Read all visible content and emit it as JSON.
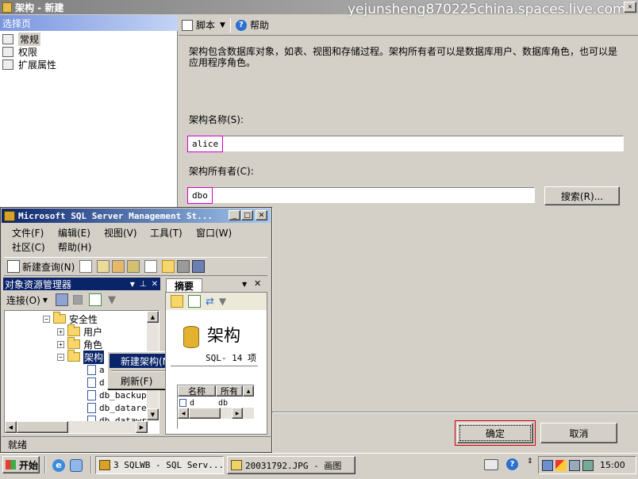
{
  "dialog": {
    "title": "架构 - 新建",
    "watermark": "yejunsheng870225china.spaces.live.com",
    "select_page_label": "选择页",
    "pages": [
      {
        "label": "常规"
      },
      {
        "label": "权限"
      },
      {
        "label": "扩展属性"
      }
    ],
    "toolbar": {
      "script_label": "脚本",
      "help_label": "帮助"
    },
    "description": "架构包含数据库对象，如表、视图和存储过程。架构所有者可以是数据库用户、数据库角色，也可以是应用程序角色。",
    "schema_name_label": "架构名称(S):",
    "schema_name_value": "alice",
    "schema_owner_label": "架构所有者(C):",
    "schema_owner_value": "dbo",
    "search_button": "搜索(R)...",
    "ok_button": "确定",
    "cancel_button": "取消"
  },
  "ssms": {
    "title": "Microsoft SQL Server Management St...",
    "menu": [
      "文件(F)",
      "编辑(E)",
      "视图(V)",
      "工具(T)",
      "窗口(W)",
      "社区(C)",
      "帮助(H)"
    ],
    "new_query": "新建查询(N)",
    "object_explorer_title": "对象资源管理器",
    "connect_label": "连接(O)",
    "tree": [
      {
        "label": "安全性"
      },
      {
        "label": "用户"
      },
      {
        "label": "角色"
      },
      {
        "label": "架构"
      },
      {
        "label": "a"
      },
      {
        "label": "d"
      },
      {
        "label": "db_backup"
      },
      {
        "label": "db_datare"
      },
      {
        "label": "db_datawr"
      }
    ],
    "context_menu": [
      "新建架构(N)...",
      "刷新(F)"
    ],
    "summary_tab": "摘要",
    "summary_title": "架构",
    "summary_subtitle": "SQL- 14 项",
    "list_headers": [
      "名称",
      "所有"
    ],
    "list_row": [
      "d",
      "db"
    ],
    "status": "就绪"
  },
  "taskbar": {
    "start": "开始",
    "tasks": [
      {
        "label": "3 SQLWB - SQL Serv..."
      },
      {
        "label": "20031792.JPG - 画图"
      }
    ],
    "clock": "15:00"
  }
}
